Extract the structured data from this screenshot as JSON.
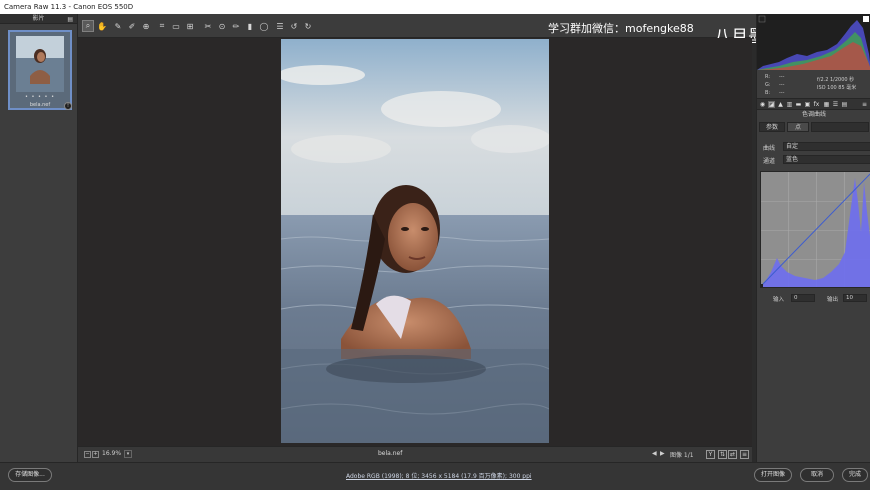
{
  "window": {
    "title": "Camera Raw 11.3 -  Canon EOS 550D"
  },
  "filmstrip": {
    "header": "影片",
    "thumbnail": {
      "filename": "bela.nef",
      "rating_dots": "• • • • •",
      "badge": "!"
    }
  },
  "watermark": {
    "text": "学习群加微信：mofengke88",
    "brand": "八月墨风",
    "logo": "bilibili"
  },
  "toolbar": {
    "tools": [
      "zoom-icon",
      "hand-icon",
      "white-balance-icon",
      "color-sampler-icon",
      "target-adjust-icon",
      "crop-icon",
      "straighten-icon",
      "transform-icon",
      "spot-removal-icon",
      "red-eye-icon",
      "adjustment-brush-icon",
      "graduated-filter-icon",
      "radial-filter-icon",
      "preferences-icon",
      "rotate-left-icon",
      "rotate-right-icon"
    ],
    "active_tool": "zoom-icon"
  },
  "viewbar": {
    "zoom_value": "16.9%",
    "filename": "bela.nef",
    "image_counter": "图像 1/1"
  },
  "readout": {
    "r_label": "R:",
    "g_label": "G:",
    "b_label": "B:",
    "r_value": "---",
    "g_value": "---",
    "b_value": "---",
    "exposure": "f/2.2   1/2000 秒",
    "iso": "ISO 100   85 毫米"
  },
  "panel": {
    "title": "色调曲线",
    "tabs": [
      "参数",
      "点"
    ],
    "active_tab": "点",
    "curve_label": "曲线",
    "curve_value": "自定",
    "channel_label": "通道",
    "channel_value": "蓝色",
    "input_label": "输入",
    "input_value": "0",
    "output_label": "输出",
    "output_value": "10"
  },
  "statusbar": {
    "save_label": "存储图像...",
    "workflow_link": "Adobe RGB (1998); 8 位; 3456 x 5184 (17.9 百万像素); 300 ppi",
    "open_label": "打开图像",
    "cancel_label": "取消",
    "done_label": "完成"
  },
  "colors": {
    "accent": "#6f8fc7",
    "curve_fill": "#6e6ef0",
    "curve_line": "#3c5cd0"
  }
}
